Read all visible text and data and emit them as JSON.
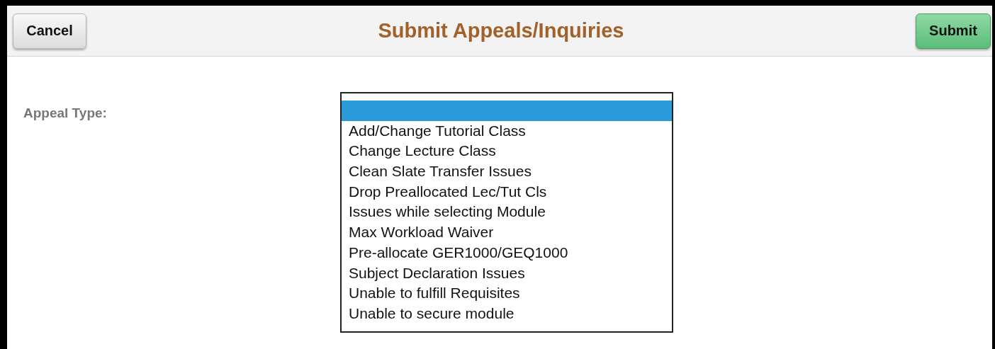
{
  "header": {
    "title": "Submit Appeals/Inquiries",
    "cancel_button": "Cancel",
    "submit_button": "Submit"
  },
  "form": {
    "label": "Appeal Type:",
    "options": [
      {
        "selected": true
      },
      {
        "label": "Add/Change Tutorial Class",
        "selected": false
      },
      {
        "label": "Change Lecture Class",
        "selected": false
      },
      {
        "label": "Clean Slate Transfer Issues",
        "selected": false
      },
      {
        "label": "Drop Preallocated Lec/Tut Cls",
        "selected": false
      },
      {
        "label": "Issues while selecting Module",
        "selected": false
      },
      {
        "label": "Max Workload Waiver",
        "selected": false
      },
      {
        "label": "Pre-allocate GER1000/GEQ1000",
        "selected": false
      },
      {
        "label": "Subject Declaration Issues",
        "selected": false
      },
      {
        "label": "Unable to fulfill Requisites",
        "selected": false
      },
      {
        "label": "Unable to secure module",
        "selected": false
      }
    ]
  }
}
